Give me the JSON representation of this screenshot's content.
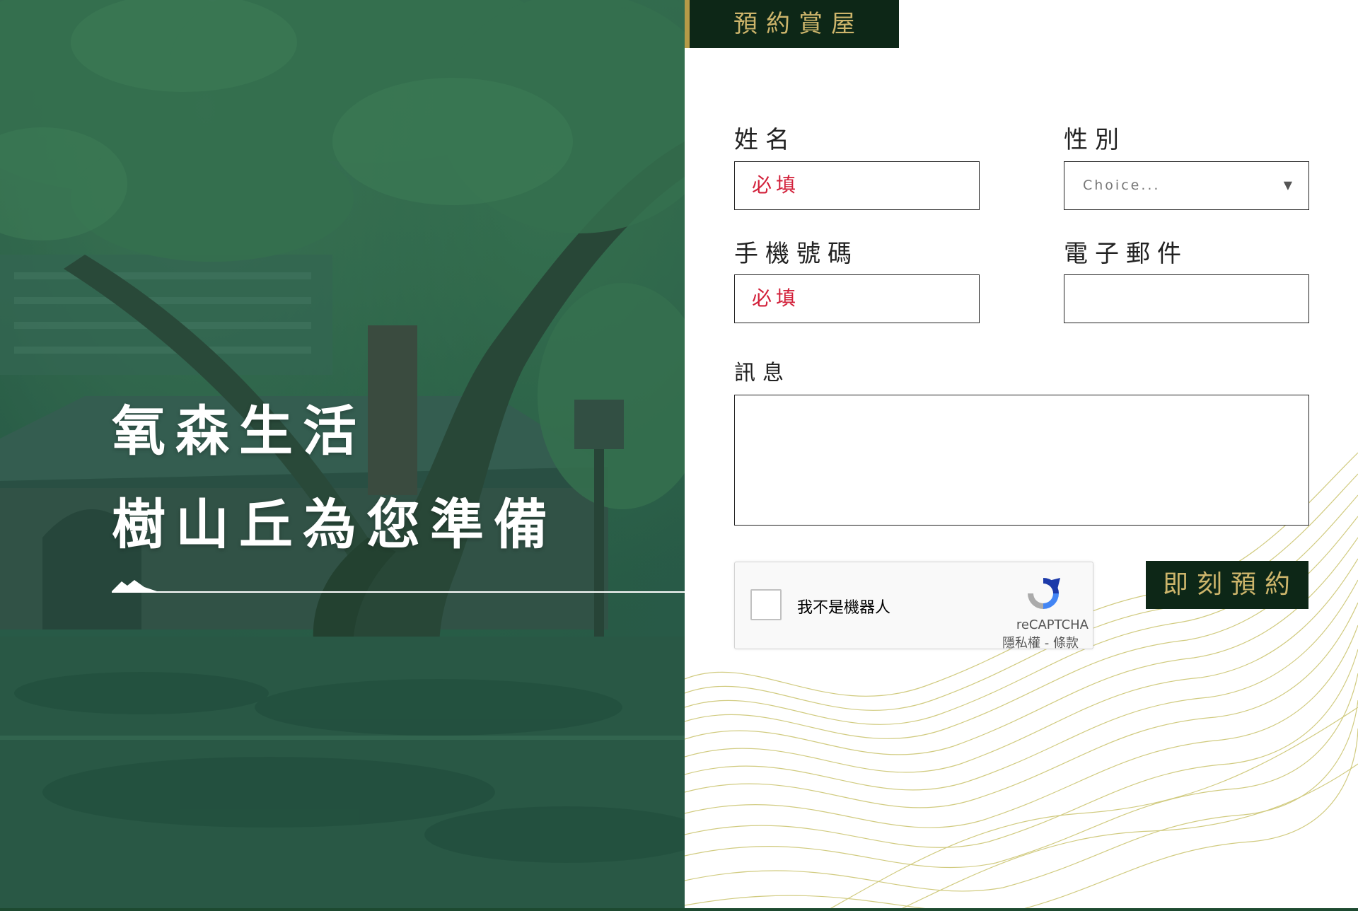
{
  "hero": {
    "title_line1": "氧森生活",
    "title_line2": "樹山丘為您準備"
  },
  "form": {
    "tab_title": "預約賞屋",
    "name_label": "姓名",
    "name_value": "必填",
    "gender_label": "性別",
    "gender_value": "Choice...",
    "phone_label": "手機號碼",
    "phone_value": "必填",
    "email_label": "電子郵件",
    "email_value": "",
    "message_label": "訊息",
    "message_value": "",
    "submit_label": "即刻預約"
  },
  "captcha": {
    "checkbox_label": "我不是機器人",
    "brand": "reCAPTCHA",
    "terms": "隱私權 - 條款"
  },
  "colors": {
    "accent_dark_green": "#0d2717",
    "accent_gold": "#cdb56b",
    "required_red": "#d2203a",
    "hero_overlay_green": "#2d5a4a",
    "wave_line": "#c9c26a"
  }
}
